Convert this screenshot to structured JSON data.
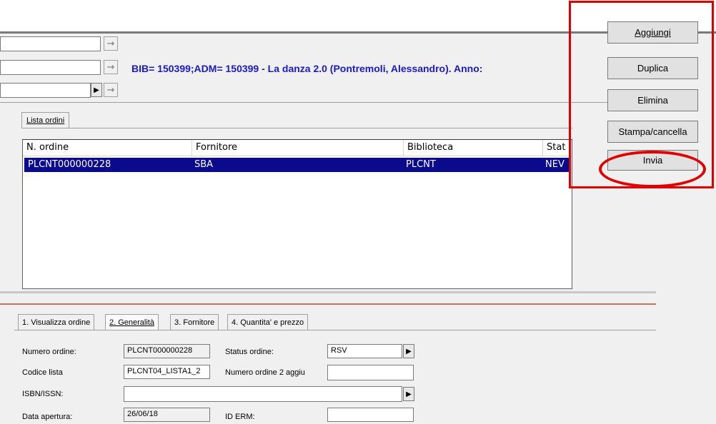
{
  "record_info": "BIB= 150399;ADM= 150399 - La danza 2.0 (Pontremoli, Alessandro). Anno:",
  "top_tab": "Lista ordini",
  "list": {
    "columns": [
      "N. ordine",
      "Fornitore",
      "Biblioteca",
      "Stat"
    ],
    "rows": [
      {
        "ordine": "PLCNT000000228",
        "fornitore": "SBA",
        "biblioteca": "PLCNT",
        "status": "NEV"
      }
    ]
  },
  "bottom_tabs": [
    "1. Visualizza ordine",
    "2. Generalità",
    "3. Fornitore",
    "4. Quantita' e prezzo"
  ],
  "form": {
    "numero_ordine_label": "Numero ordine:",
    "numero_ordine_value": "PLCNT000000228",
    "status_ordine_label": "Status ordine:",
    "status_ordine_value": "RSV",
    "codice_lista_label": "Codice lista",
    "codice_lista_value": "PLCNT04_LISTA1_2",
    "numero_ordine2_label": "Numero ordine 2 aggiu",
    "numero_ordine2_value": "",
    "isbn_label": "ISBN/ISSN:",
    "isbn_value": "",
    "data_apertura_label": "Data apertura:",
    "data_apertura_value": "26/06/18",
    "id_erm_label": "ID ERM:",
    "id_erm_value": ""
  },
  "actions": {
    "aggiungi": "Aggiungi",
    "duplica": "Duplica",
    "elimina": "Elimina",
    "stampa": "Stampa/cancella",
    "invia": "Invia"
  },
  "colors": {
    "selection": "#0a0a8c",
    "info_text": "#1a1acc",
    "highlight": "#e00000"
  }
}
